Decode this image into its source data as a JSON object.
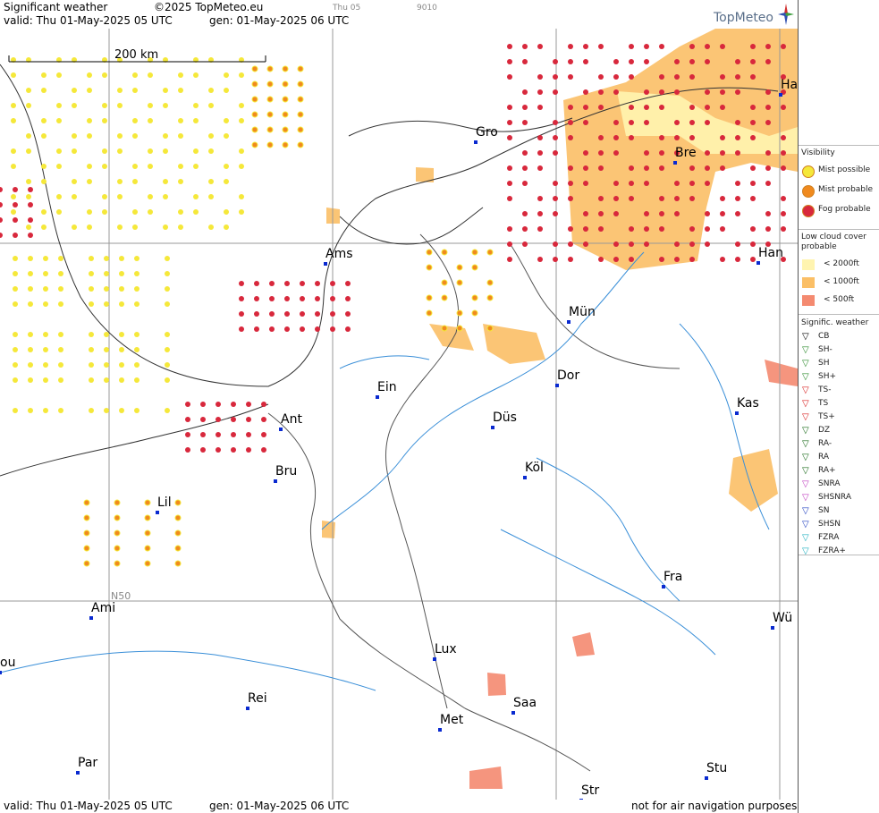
{
  "header": {
    "product": "Significant weather",
    "copyright": "©2025 TopMeteo.eu",
    "valid": "valid:  Thu   01-May-2025  05 UTC",
    "generated": "gen:  01-May-2025 06 UTC",
    "day_small": "Thu 05",
    "code_small": "9010",
    "logo": "TopMeteo"
  },
  "scale": {
    "label": "200 km"
  },
  "grid_label": "N50",
  "cities": [
    {
      "name": "Gro"
    },
    {
      "name": "Bre"
    },
    {
      "name": "Ha"
    },
    {
      "name": "Ams"
    },
    {
      "name": "Han"
    },
    {
      "name": "Mün"
    },
    {
      "name": "Dor"
    },
    {
      "name": "Ein"
    },
    {
      "name": "Kas"
    },
    {
      "name": "Ant"
    },
    {
      "name": "Düs"
    },
    {
      "name": "Bru"
    },
    {
      "name": "Köl"
    },
    {
      "name": "Lil"
    },
    {
      "name": "Fra"
    },
    {
      "name": "Ami"
    },
    {
      "name": "Wü"
    },
    {
      "name": "Lux"
    },
    {
      "name": "ou"
    },
    {
      "name": "Rei"
    },
    {
      "name": "Saa"
    },
    {
      "name": "Met"
    },
    {
      "name": "Par"
    },
    {
      "name": "Stu"
    },
    {
      "name": "Str"
    }
  ],
  "footer": {
    "valid": "valid:  Thu   01-May-2025  05 UTC",
    "generated": "gen:  01-May-2025 06 UTC",
    "disclaimer": "not for air navigation purposes"
  },
  "legend": {
    "visibility_title": "Visibility",
    "visibility": [
      {
        "label": "Mist possible",
        "color": "#f5e83a"
      },
      {
        "label": "Mist probable",
        "color": "#f08a1e"
      },
      {
        "label": "Fog probable",
        "color": "#d8283c"
      }
    ],
    "low_cloud_title": "Low cloud cover probable",
    "low_cloud": [
      {
        "label": "< 2000ft",
        "color": "#fff4b0"
      },
      {
        "label": "< 1000ft",
        "color": "#fbbf66"
      },
      {
        "label": "<   500ft",
        "color": "#f48a70"
      }
    ],
    "signif_title": "Signific. weather",
    "signif": [
      {
        "label": "CB",
        "icon": "cb-icon",
        "color": "#000000"
      },
      {
        "label": "SH-",
        "icon": "shower-light-icon",
        "color": "#2a8a2a"
      },
      {
        "label": "SH",
        "icon": "shower-icon",
        "color": "#2a8a2a"
      },
      {
        "label": "SH+",
        "icon": "shower-heavy-icon",
        "color": "#2a8a2a"
      },
      {
        "label": "TS-",
        "icon": "thunder-light-icon",
        "color": "#d82020"
      },
      {
        "label": "TS",
        "icon": "thunder-icon",
        "color": "#d82020"
      },
      {
        "label": "TS+",
        "icon": "thunder-heavy-icon",
        "color": "#d82020"
      },
      {
        "label": "DZ",
        "icon": "drizzle-icon",
        "color": "#1a6a1a"
      },
      {
        "label": "RA-",
        "icon": "rain-light-icon",
        "color": "#1a6a1a"
      },
      {
        "label": "RA",
        "icon": "rain-icon",
        "color": "#1a6a1a"
      },
      {
        "label": "RA+",
        "icon": "rain-heavy-icon",
        "color": "#1a6a1a"
      },
      {
        "label": "SNRA",
        "icon": "sleet-icon",
        "color": "#c040c0"
      },
      {
        "label": "SHSNRA",
        "icon": "sleet-shower-icon",
        "color": "#c040c0"
      },
      {
        "label": "SN",
        "icon": "snow-icon",
        "color": "#2040c0"
      },
      {
        "label": "SHSN",
        "icon": "snow-shower-icon",
        "color": "#2040c0"
      },
      {
        "label": "FZRA",
        "icon": "freezing-rain-icon",
        "color": "#20b0c0"
      },
      {
        "label": "FZRA+",
        "icon": "freezing-rain-heavy-icon",
        "color": "#20b0c0"
      }
    ]
  }
}
